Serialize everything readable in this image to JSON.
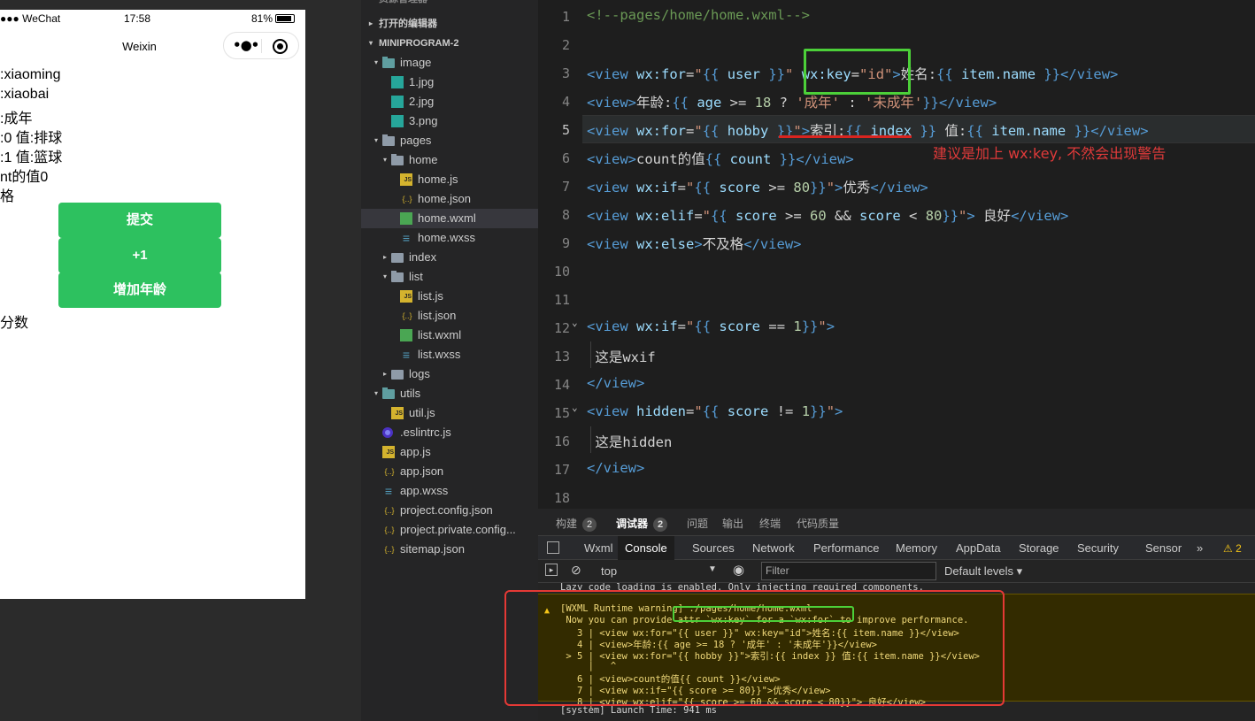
{
  "simulator": {
    "status_left": "●●● WeChat",
    "time": "17:58",
    "battery": "81%",
    "nav_title": "Weixin",
    "lines": [
      ":xiaoming",
      ":xiaobai",
      ":成年",
      ":0 值:排球",
      ":1 值:篮球",
      "nt的值0",
      "格",
      "分数"
    ],
    "buttons": [
      "提交",
      "+1",
      "增加年龄"
    ]
  },
  "explorer": {
    "header_top": "资源管理器",
    "open_editors": "打开的编辑器",
    "project": "MINIPROGRAM-2",
    "items": [
      {
        "label": "image",
        "type": "folder-img",
        "depth": 1,
        "arrow": "▾"
      },
      {
        "label": "1.jpg",
        "type": "png",
        "depth": 2
      },
      {
        "label": "2.jpg",
        "type": "png",
        "depth": 2
      },
      {
        "label": "3.png",
        "type": "png",
        "depth": 2
      },
      {
        "label": "pages",
        "type": "folder",
        "depth": 1,
        "arrow": "▾"
      },
      {
        "label": "home",
        "type": "folder",
        "depth": 2,
        "arrow": "▾"
      },
      {
        "label": "home.js",
        "type": "js",
        "depth": 3
      },
      {
        "label": "home.json",
        "type": "json",
        "depth": 3
      },
      {
        "label": "home.wxml",
        "type": "wxml",
        "depth": 3,
        "selected": true
      },
      {
        "label": "home.wxss",
        "type": "wxss",
        "depth": 3
      },
      {
        "label": "index",
        "type": "folder",
        "depth": 2,
        "arrow": "▸"
      },
      {
        "label": "list",
        "type": "folder",
        "depth": 2,
        "arrow": "▾"
      },
      {
        "label": "list.js",
        "type": "js",
        "depth": 3
      },
      {
        "label": "list.json",
        "type": "json",
        "depth": 3
      },
      {
        "label": "list.wxml",
        "type": "wxml",
        "depth": 3
      },
      {
        "label": "list.wxss",
        "type": "wxss",
        "depth": 3
      },
      {
        "label": "logs",
        "type": "folder",
        "depth": 2,
        "arrow": "▸"
      },
      {
        "label": "utils",
        "type": "folder-img",
        "depth": 1,
        "arrow": "▾"
      },
      {
        "label": "util.js",
        "type": "js",
        "depth": 2
      },
      {
        "label": ".eslintrc.js",
        "type": "eslint",
        "depth": 1
      },
      {
        "label": "app.js",
        "type": "js",
        "depth": 1
      },
      {
        "label": "app.json",
        "type": "json",
        "depth": 1
      },
      {
        "label": "app.wxss",
        "type": "wxss",
        "depth": 1
      },
      {
        "label": "project.config.json",
        "type": "json",
        "depth": 1
      },
      {
        "label": "project.private.config...",
        "type": "json",
        "depth": 1
      },
      {
        "label": "sitemap.json",
        "type": "json",
        "depth": 1
      }
    ]
  },
  "editor": {
    "annotation": "建议是加上 wx:key, 不然会出现警告",
    "current_line": "5",
    "lines": [
      {
        "no": "1",
        "segs": [
          [
            "c-com",
            "<!--pages/home/home.wxml-->"
          ]
        ]
      },
      {
        "no": "2",
        "segs": []
      },
      {
        "no": "3",
        "segs": [
          [
            "c-tag",
            "<view "
          ],
          [
            "c-attr",
            "wx:for"
          ],
          [
            "c-op",
            "="
          ],
          [
            "c-str",
            "\""
          ],
          [
            "c-tag",
            "{{ "
          ],
          [
            "c-attr",
            "user"
          ],
          [
            "c-tag",
            " }}"
          ],
          [
            "c-str",
            "\" "
          ],
          [
            "c-attr",
            "wx:key"
          ],
          [
            "c-op",
            "="
          ],
          [
            "c-str",
            "\"id\""
          ],
          [
            "c-tag",
            ">"
          ],
          [
            "c-txt",
            "姓名:"
          ],
          [
            "c-tag",
            "{{ "
          ],
          [
            "c-attr",
            "item.name"
          ],
          [
            "c-tag",
            " }}"
          ],
          [
            "c-tag",
            "</view>"
          ]
        ]
      },
      {
        "no": "4",
        "segs": [
          [
            "c-tag",
            "<view>"
          ],
          [
            "c-txt",
            "年龄:"
          ],
          [
            "c-tag",
            "{{ "
          ],
          [
            "c-attr",
            "age"
          ],
          [
            "c-op",
            " >= "
          ],
          [
            "c-num",
            "18"
          ],
          [
            "c-op",
            " ? "
          ],
          [
            "c-str",
            "'成年'"
          ],
          [
            "c-op",
            " : "
          ],
          [
            "c-str",
            "'未成年'"
          ],
          [
            "c-tag",
            "}}"
          ],
          [
            "c-tag",
            "</view>"
          ]
        ]
      },
      {
        "no": "5",
        "segs": [
          [
            "c-tag",
            "<view "
          ],
          [
            "c-attr",
            "wx:for"
          ],
          [
            "c-op",
            "="
          ],
          [
            "c-str",
            "\""
          ],
          [
            "c-tag",
            "{{ "
          ],
          [
            "c-attr",
            "hobby"
          ],
          [
            "c-tag",
            " }}"
          ],
          [
            "c-str",
            "\""
          ],
          [
            "c-tag",
            ">"
          ],
          [
            "c-txt",
            "索引:"
          ],
          [
            "c-tag",
            "{{ "
          ],
          [
            "c-attr",
            "index"
          ],
          [
            "c-tag",
            " }}"
          ],
          [
            "c-txt",
            " 值:"
          ],
          [
            "c-tag",
            "{{ "
          ],
          [
            "c-attr",
            "item.name"
          ],
          [
            "c-tag",
            " }}"
          ],
          [
            "c-tag",
            "</view>"
          ]
        ]
      },
      {
        "no": "6",
        "segs": [
          [
            "c-tag",
            "<view>"
          ],
          [
            "c-txt",
            "count的值"
          ],
          [
            "c-tag",
            "{{ "
          ],
          [
            "c-attr",
            "count"
          ],
          [
            "c-tag",
            " }}"
          ],
          [
            "c-tag",
            "</view>"
          ]
        ]
      },
      {
        "no": "7",
        "segs": [
          [
            "c-tag",
            "<view "
          ],
          [
            "c-attr",
            "wx:if"
          ],
          [
            "c-op",
            "="
          ],
          [
            "c-str",
            "\""
          ],
          [
            "c-tag",
            "{{ "
          ],
          [
            "c-attr",
            "score"
          ],
          [
            "c-op",
            " >= "
          ],
          [
            "c-num",
            "80"
          ],
          [
            "c-tag",
            "}}"
          ],
          [
            "c-str",
            "\""
          ],
          [
            "c-tag",
            ">"
          ],
          [
            "c-txt",
            "优秀"
          ],
          [
            "c-tag",
            "</view>"
          ]
        ]
      },
      {
        "no": "8",
        "segs": [
          [
            "c-tag",
            "<view "
          ],
          [
            "c-attr",
            "wx:elif"
          ],
          [
            "c-op",
            "="
          ],
          [
            "c-str",
            "\""
          ],
          [
            "c-tag",
            "{{ "
          ],
          [
            "c-attr",
            "score"
          ],
          [
            "c-op",
            " >= "
          ],
          [
            "c-num",
            "60"
          ],
          [
            "c-op",
            " && "
          ],
          [
            "c-attr",
            "score"
          ],
          [
            "c-op",
            " < "
          ],
          [
            "c-num",
            "80"
          ],
          [
            "c-tag",
            "}}"
          ],
          [
            "c-str",
            "\""
          ],
          [
            "c-tag",
            ">"
          ],
          [
            "c-txt",
            " 良好"
          ],
          [
            "c-tag",
            "</view>"
          ]
        ]
      },
      {
        "no": "9",
        "segs": [
          [
            "c-tag",
            "<view "
          ],
          [
            "c-attr",
            "wx:else"
          ],
          [
            "c-tag",
            ">"
          ],
          [
            "c-txt",
            "不及格"
          ],
          [
            "c-tag",
            "</view>"
          ]
        ]
      },
      {
        "no": "10",
        "segs": []
      },
      {
        "no": "11",
        "segs": []
      },
      {
        "no": "12",
        "segs": [
          [
            "c-tag",
            "<view "
          ],
          [
            "c-attr",
            "wx:if"
          ],
          [
            "c-op",
            "="
          ],
          [
            "c-str",
            "\""
          ],
          [
            "c-tag",
            "{{ "
          ],
          [
            "c-attr",
            "score"
          ],
          [
            "c-op",
            " == "
          ],
          [
            "c-num",
            "1"
          ],
          [
            "c-tag",
            "}}"
          ],
          [
            "c-str",
            "\""
          ],
          [
            "c-tag",
            ">"
          ]
        ],
        "fold": true
      },
      {
        "no": "13",
        "segs": [
          [
            "c-txt",
            " 这是wxif"
          ]
        ]
      },
      {
        "no": "14",
        "segs": [
          [
            "c-tag",
            "</view>"
          ]
        ]
      },
      {
        "no": "15",
        "segs": [
          [
            "c-tag",
            "<view "
          ],
          [
            "c-attr",
            "hidden"
          ],
          [
            "c-op",
            "="
          ],
          [
            "c-str",
            "\""
          ],
          [
            "c-tag",
            "{{ "
          ],
          [
            "c-attr",
            "score"
          ],
          [
            "c-op",
            " != "
          ],
          [
            "c-num",
            "1"
          ],
          [
            "c-tag",
            "}}"
          ],
          [
            "c-str",
            "\""
          ],
          [
            "c-tag",
            ">"
          ]
        ],
        "fold": true
      },
      {
        "no": "16",
        "segs": [
          [
            "c-txt",
            " 这是hidden"
          ]
        ]
      },
      {
        "no": "17",
        "segs": [
          [
            "c-tag",
            "</view>"
          ]
        ]
      },
      {
        "no": "18",
        "segs": []
      }
    ]
  },
  "panel": {
    "tabs": [
      {
        "label": "构建",
        "count": "2"
      },
      {
        "label": "调试器",
        "count": "2",
        "active": true
      },
      {
        "label": "问题"
      },
      {
        "label": "输出"
      },
      {
        "label": "终端"
      },
      {
        "label": "代码质量"
      }
    ],
    "devtools_tabs": [
      "Wxml",
      "Console",
      "Sources",
      "Network",
      "Performance",
      "Memory",
      "AppData",
      "Storage",
      "Security",
      "Sensor"
    ],
    "devtools_active": "Console",
    "more": "»",
    "warn_count": "⚠ 2",
    "context": "top",
    "filter_placeholder": "Filter",
    "levels": "Default levels ▾",
    "console_lines": {
      "lazy": "Lazy code loading is enabled. Only injecting required components.",
      "warn": [
        "[WXML Runtime warning] ./pages/home/home.wxml",
        " Now you can provide attr `wx:key` for a `wx:for` to improve performance.",
        "   3 | <view wx:for=\"{{ user }}\" wx:key=\"id\">姓名:{{ item.name }}</view>",
        "   4 | <view>年龄:{{ age >= 18 ? '成年' : '未成年'}}</view>",
        " > 5 | <view wx:for=\"{{ hobby }}\">索引:{{ index }} 值:{{ item.name }}</view>",
        "     |   ^",
        "   6 | <view>count的值{{ count }}</view>",
        "   7 | <view wx:if=\"{{ score >= 80}}\">优秀</view>",
        "   8 | <view wx:elif=\"{{ score >= 60 && score < 80}}\"> 良好</view>"
      ],
      "system": "[system] Launch Time: 941 ms"
    }
  }
}
